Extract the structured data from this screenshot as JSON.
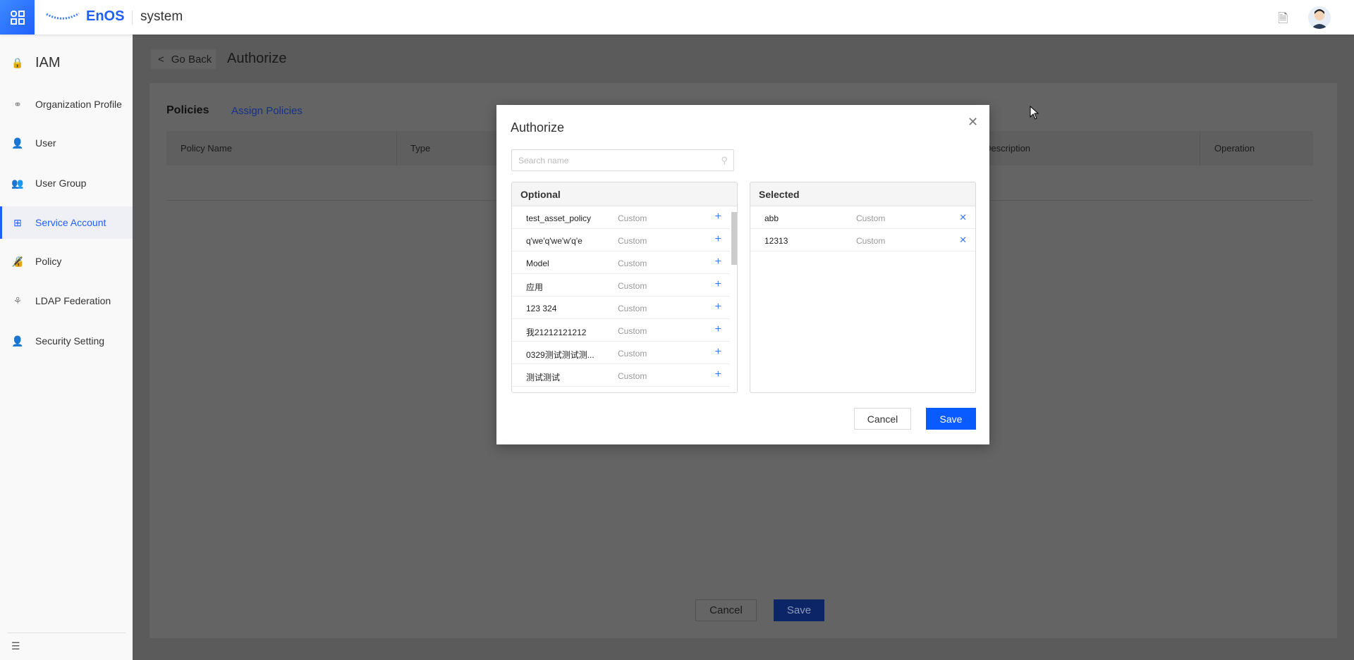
{
  "header": {
    "brand": "EnOS",
    "app": "system",
    "icons": [
      "app-grid-icon",
      "document-icon",
      "avatar"
    ]
  },
  "sidebar": {
    "title": "IAM",
    "items": [
      {
        "label": "Organization Profile",
        "icon": "organization-icon"
      },
      {
        "label": "User",
        "icon": "user-icon"
      },
      {
        "label": "User Group",
        "icon": "user-group-icon"
      },
      {
        "label": "Service Account",
        "icon": "service-account-icon",
        "active": true
      },
      {
        "label": "Policy",
        "icon": "policy-icon"
      },
      {
        "label": "LDAP Federation",
        "icon": "ldap-icon"
      },
      {
        "label": "Security Setting",
        "icon": "security-icon"
      }
    ]
  },
  "page": {
    "back": "Go Back",
    "title": "Authorize",
    "tabs": [
      "Policies",
      "Assign Policies"
    ],
    "columns": [
      "Policy Name",
      "Type",
      "Description",
      "Operation"
    ],
    "cancel": "Cancel",
    "save": "Save"
  },
  "modal": {
    "title": "Authorize",
    "search_placeholder": "Search name",
    "optional": {
      "title": "Optional",
      "rows": [
        {
          "name": "test_asset_policy",
          "type": "Custom"
        },
        {
          "name": "q'we'q'we'w'q'e",
          "type": "Custom"
        },
        {
          "name": "Model",
          "type": "Custom"
        },
        {
          "name": "应用",
          "type": "Custom"
        },
        {
          "name": "123 324",
          "type": "Custom"
        },
        {
          "name": "我21212121212",
          "type": "Custom"
        },
        {
          "name": "0329测试测试测...",
          "type": "Custom"
        },
        {
          "name": "测试测试",
          "type": "Custom"
        }
      ]
    },
    "selected": {
      "title": "Selected",
      "rows": [
        {
          "name": "abb",
          "type": "Custom"
        },
        {
          "name": "12313",
          "type": "Custom"
        }
      ]
    },
    "cancel": "Cancel",
    "save": "Save"
  },
  "colors": {
    "accent": "#1f5fff"
  }
}
